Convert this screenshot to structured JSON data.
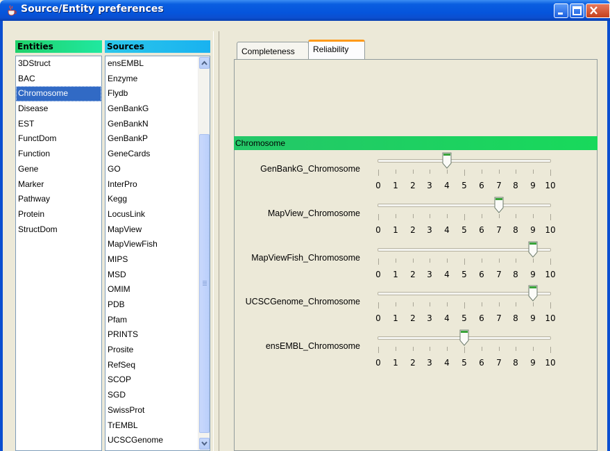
{
  "window": {
    "title": "Source/Entity preferences",
    "icon": "java-cup-icon",
    "buttons": [
      "minimize",
      "maximize",
      "close"
    ]
  },
  "entities": {
    "header": "Entities",
    "selected": "Chromosome",
    "items": [
      "3DStruct",
      "BAC",
      "Chromosome",
      "Disease",
      "EST",
      "FunctDom",
      "Function",
      "Gene",
      "Marker",
      "Pathway",
      "Protein",
      "StructDom"
    ]
  },
  "sources": {
    "header": "Sources",
    "items": [
      "ensEMBL",
      "Enzyme",
      "Flydb",
      "GenBankG",
      "GenBankN",
      "GenBankP",
      "GeneCards",
      "GO",
      "InterPro",
      "Kegg",
      "LocusLink",
      "MapView",
      "MapViewFish",
      "MIPS",
      "MSD",
      "OMIM",
      "PDB",
      "Pfam",
      "PRINTS",
      "Prosite",
      "RefSeq",
      "SCOP",
      "SGD",
      "SwissProt",
      "TrEMBL",
      "UCSCGenome"
    ]
  },
  "tabs": [
    {
      "label": "Completeness",
      "active": false
    },
    {
      "label": "Reliability",
      "active": true
    }
  ],
  "reliability": {
    "entity": "Chromosome",
    "scale": [
      "0",
      "1",
      "2",
      "3",
      "4",
      "5",
      "6",
      "7",
      "8",
      "9",
      "10"
    ],
    "sliders": [
      {
        "label": "GenBankG_Chromosome",
        "value": 4
      },
      {
        "label": "MapView_Chromosome",
        "value": 7
      },
      {
        "label": "MapViewFish_Chromosome",
        "value": 9
      },
      {
        "label": "UCSCGenome_Chromosome",
        "value": 9
      },
      {
        "label": "ensEMBL_Chromosome",
        "value": 5
      }
    ]
  },
  "colors": {
    "titlebar": "#0555dc",
    "entities_header": "#1fd16a",
    "sources_header": "#19b2f0",
    "selection": "#316ac5",
    "entity_banner": "#18d95b",
    "active_tab_accent": "#ff9a1a",
    "slider_thumb_accent": "#3aa43a"
  }
}
